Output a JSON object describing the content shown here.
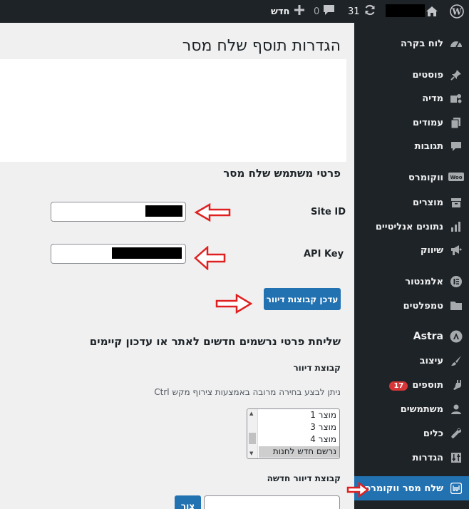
{
  "adminbar": {
    "updates_count": "31",
    "comments_count": "0",
    "new_label": "חדש",
    "icons": [
      "wordpress-logo-icon",
      "home-icon",
      "updates-icon",
      "comments-icon",
      "plus-icon"
    ]
  },
  "sidebar": {
    "items": [
      {
        "label": "לוח בקרה",
        "icon": "dashboard-icon"
      },
      {
        "label": "פוסטים",
        "icon": "pin-icon"
      },
      {
        "label": "מדיה",
        "icon": "media-icon"
      },
      {
        "label": "עמודים",
        "icon": "pages-icon"
      },
      {
        "label": "תגובות",
        "icon": "comment-icon"
      },
      {
        "label": "ווקומרס",
        "icon": "woo-icon"
      },
      {
        "label": "מוצרים",
        "icon": "archive-icon"
      },
      {
        "label": "נתונים אנליטיים",
        "icon": "chart-bar-icon"
      },
      {
        "label": "שיווק",
        "icon": "megaphone-icon"
      },
      {
        "label": "אלמנטור",
        "icon": "elementor-icon"
      },
      {
        "label": "טמפלטים",
        "icon": "folder-icon"
      },
      {
        "label": "Astra",
        "icon": "astra-icon"
      },
      {
        "label": "עיצוב",
        "icon": "brush-icon"
      },
      {
        "label": "תוספים",
        "icon": "plugin-icon",
        "badge": "17"
      },
      {
        "label": "משתמשים",
        "icon": "user-icon"
      },
      {
        "label": "כלים",
        "icon": "wrench-icon"
      },
      {
        "label": "הגדרות",
        "icon": "settings-icon"
      },
      {
        "label": "שלח מסר ווקומרס",
        "icon": "plugin-brand-icon",
        "active": true
      }
    ]
  },
  "page": {
    "title": "הגדרות תוסף שלח מסר",
    "section1_title": "פרטי משתמש שלח מסר",
    "site_id_label": "Site ID",
    "api_key_label": "API Key",
    "update_groups_button": "עדכן קבוצות דיוור",
    "section2_title": "שליחת פרטי נרשמים חדשים לאתר או עדכון קיימים",
    "group_label": "קבוצת דיוור",
    "help_text": "ניתן לבצע בחירה מרובה באמצעות צירוף מקש Ctrl",
    "group_options": [
      "מוצר 1",
      "מוצר 3",
      "מוצר 4",
      "נרשם חדש לחנות"
    ],
    "new_group_label": "קבוצת דיוור חדשה",
    "create_button": "צור"
  },
  "colors": {
    "adminbar_bg": "#1d2327",
    "sidebar_bg": "#1d2327",
    "active_menu": "#2271b1",
    "primary_button": "#2271b1",
    "badge": "#d63638",
    "annotation_arrow": "#e02020"
  }
}
